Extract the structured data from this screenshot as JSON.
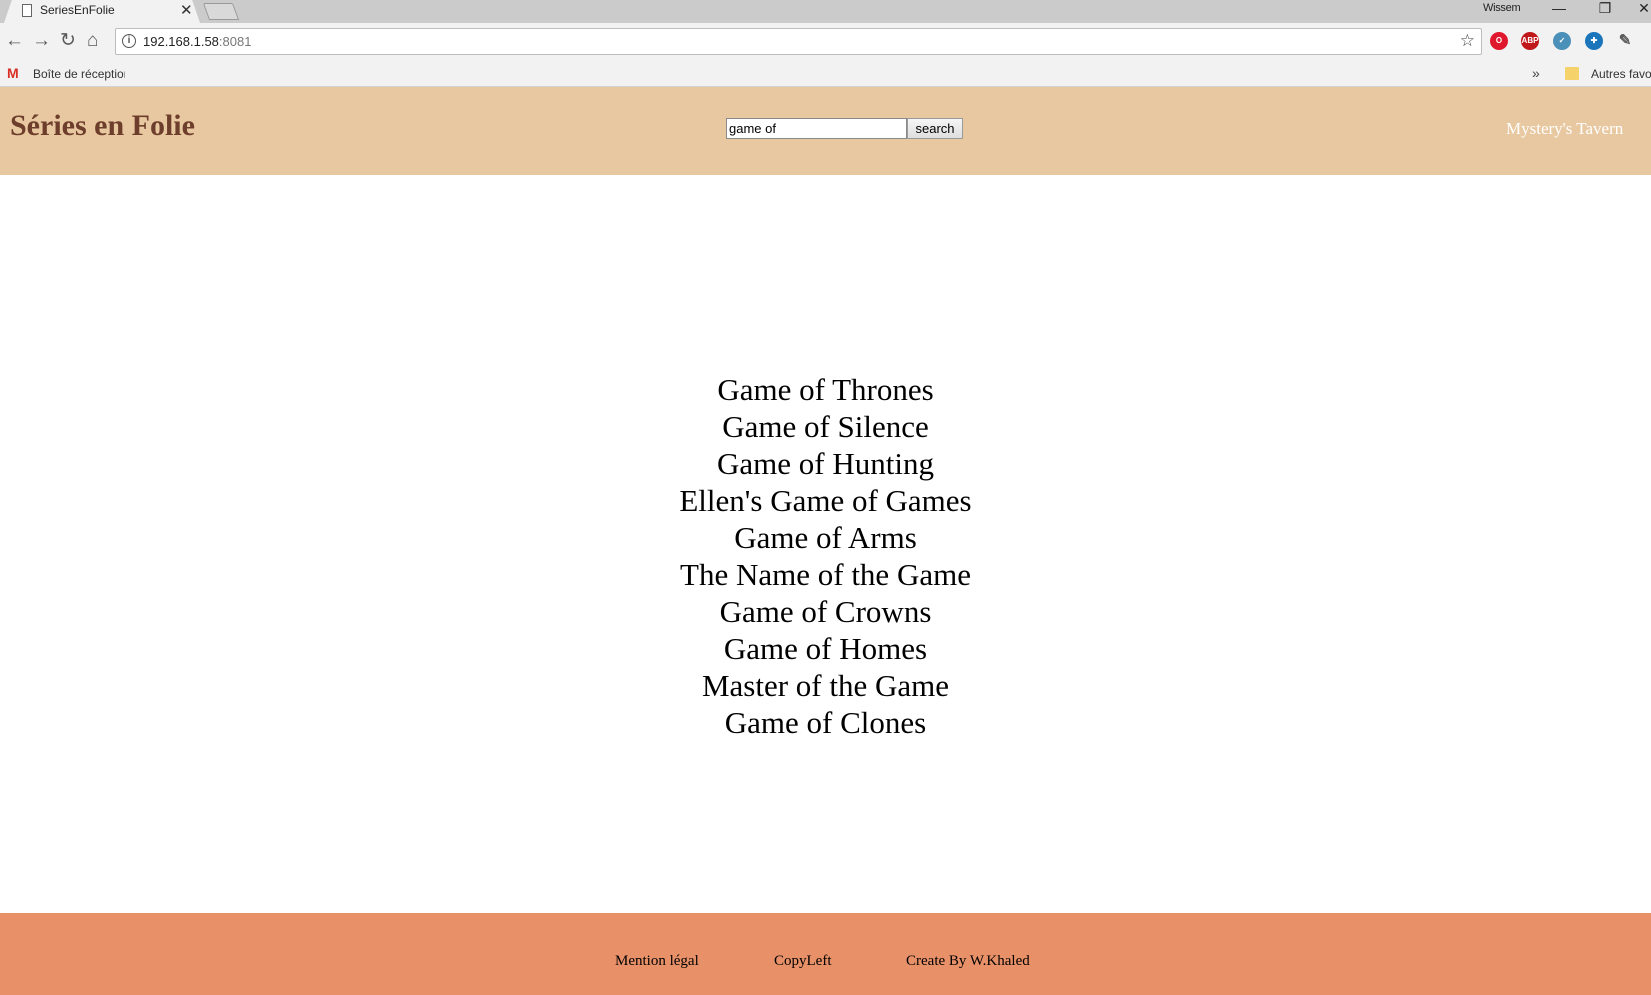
{
  "browser": {
    "tab_title": "SeriesEnFolie",
    "user_name": "Wissem",
    "url_host": "192.168.1.58",
    "url_port": ":8081",
    "bookmarks": {
      "gmail_label": "Boîte de réception",
      "other_label": "Autres favoris"
    },
    "icons": {
      "back": "←",
      "forward": "→",
      "reload": "↻",
      "home": "⌂",
      "star": "☆",
      "close": "✕",
      "minimize": "—",
      "restore": "❐",
      "more": "»"
    },
    "extensions": [
      {
        "name": "opera-icon",
        "glyph": "O",
        "color": "#e0182d"
      },
      {
        "name": "adblock-icon",
        "glyph": "ABP",
        "color": "#c0171b"
      },
      {
        "name": "shield-extension-icon",
        "glyph": "✓",
        "color": "#4a90b8"
      },
      {
        "name": "ghostery-icon",
        "glyph": "✚",
        "color": "#1b75bb"
      },
      {
        "name": "eyedropper-icon",
        "glyph": "✎",
        "color": "#5a5a5a"
      }
    ]
  },
  "header": {
    "title": "Séries en Folie",
    "search_value": "game of",
    "search_button": "search",
    "link": "Mystery's Tavern",
    "background": "#e8c8a0",
    "title_color": "#6e3e2c"
  },
  "results": [
    "Game of Thrones",
    "Game of Silence",
    "Game of Hunting",
    "Ellen's Game of Games",
    "Game of Arms",
    "The Name of the Game",
    "Game of Crowns",
    "Game of Homes",
    "Master of the Game",
    "Game of Clones"
  ],
  "footer": {
    "links": [
      "Mention légal",
      "CopyLeft",
      "Create By W.Khaled"
    ],
    "background": "#e89168"
  }
}
